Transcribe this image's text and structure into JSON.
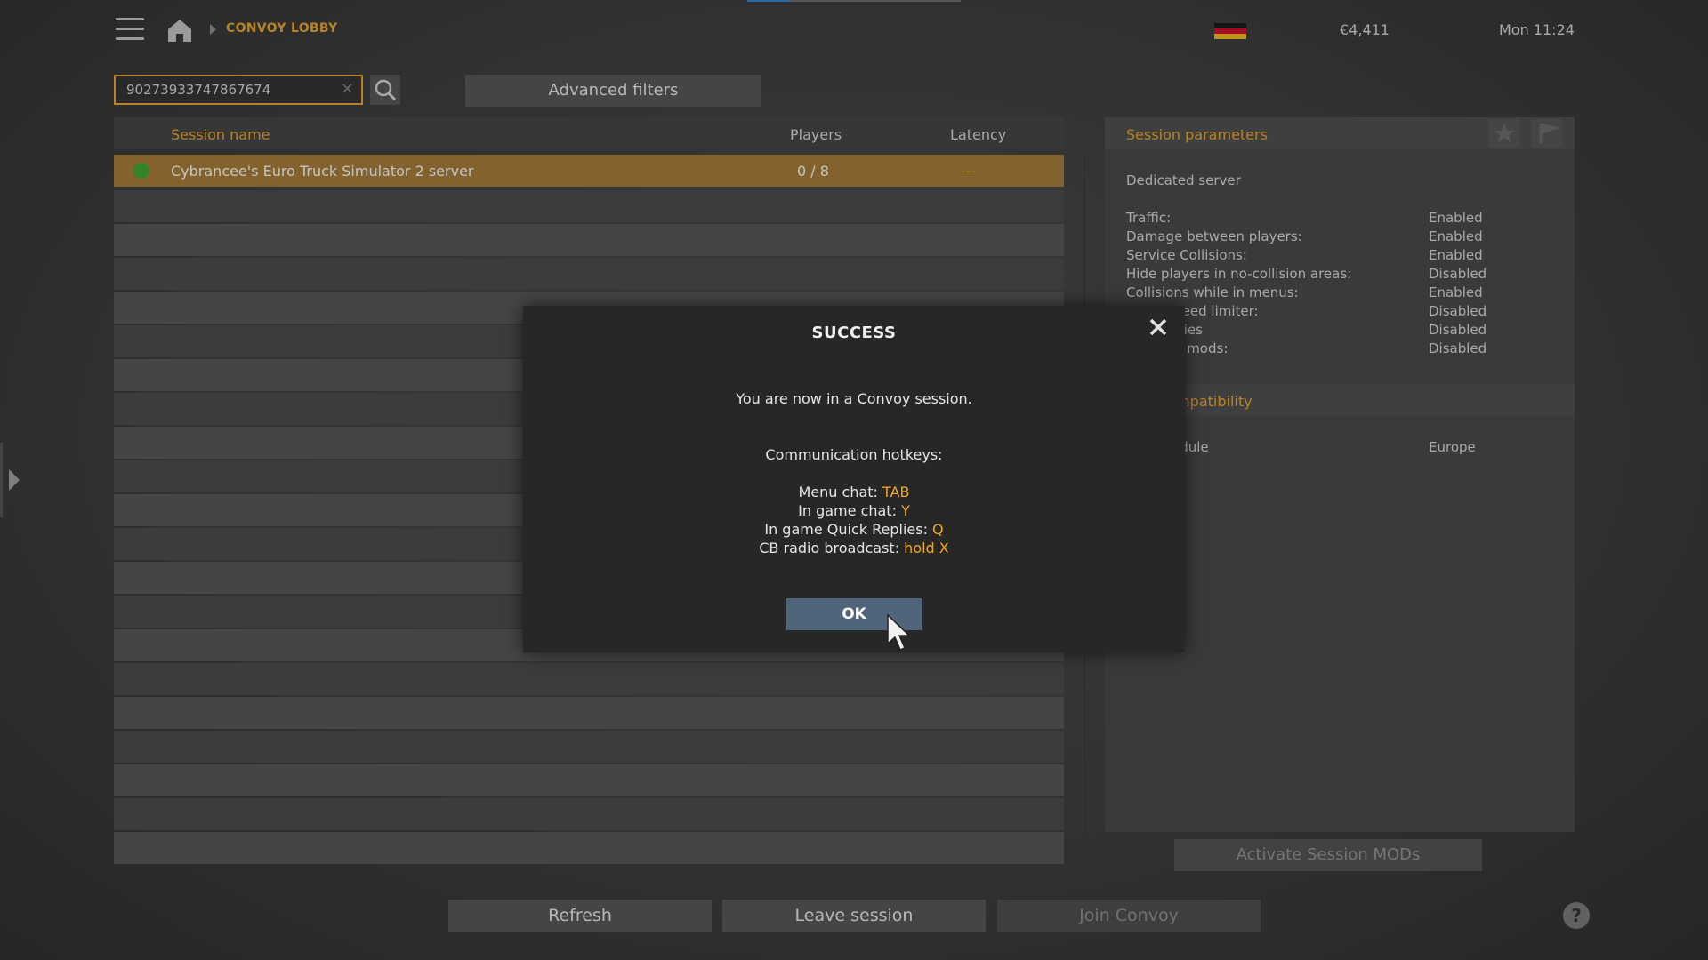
{
  "header": {
    "breadcrumb": "CONVOY LOBBY",
    "money": "€4,411",
    "time": "Mon 11:24",
    "flag_colors": [
      "#1a1a1a",
      "#c8102e",
      "#e8b820"
    ]
  },
  "search": {
    "value": "90273933747867674",
    "advanced_filters_label": "Advanced filters"
  },
  "table": {
    "columns": {
      "name": "Session name",
      "players": "Players",
      "latency": "Latency"
    },
    "rows": [
      {
        "name": "Cybrancee's Euro Truck Simulator 2 server",
        "players": "0 / 8",
        "latency": "---",
        "status_color": "#40a030"
      }
    ]
  },
  "params": {
    "title": "Session parameters",
    "server_type": "Dedicated server",
    "items": [
      {
        "label": "Traffic:",
        "value": "Enabled"
      },
      {
        "label": "Damage between players:",
        "value": "Enabled"
      },
      {
        "label": "Service Collisions:",
        "value": "Enabled"
      },
      {
        "label": "Hide players in no-collision areas:",
        "value": "Disabled"
      },
      {
        "label": "Collisions while in menus:",
        "value": "Enabled"
      },
      {
        "label": "Force speed limiter:",
        "value": "Disabled"
      },
      {
        "label": "Time series",
        "value": "Disabled"
      },
      {
        "label": "Optional mods:",
        "value": "Disabled"
      }
    ],
    "dlc_title": "DLC compatibility",
    "map_label": "Map module",
    "map_value": "Europe",
    "activate_mods_label": "Activate Session MODs"
  },
  "buttons": {
    "refresh": "Refresh",
    "leave": "Leave session",
    "join": "Join Convoy",
    "help": "?"
  },
  "modal": {
    "title": "SUCCESS",
    "message": "You are now in a Convoy session.",
    "hotkeys_title": "Communication hotkeys:",
    "hotkeys": [
      {
        "label": "Menu chat: ",
        "key": "TAB"
      },
      {
        "label": "In game chat: ",
        "key": "Y"
      },
      {
        "label": "In game Quick Replies: ",
        "key": "Q"
      },
      {
        "label": "CB radio broadcast: ",
        "key": "hold X"
      }
    ],
    "ok_label": "OK"
  }
}
